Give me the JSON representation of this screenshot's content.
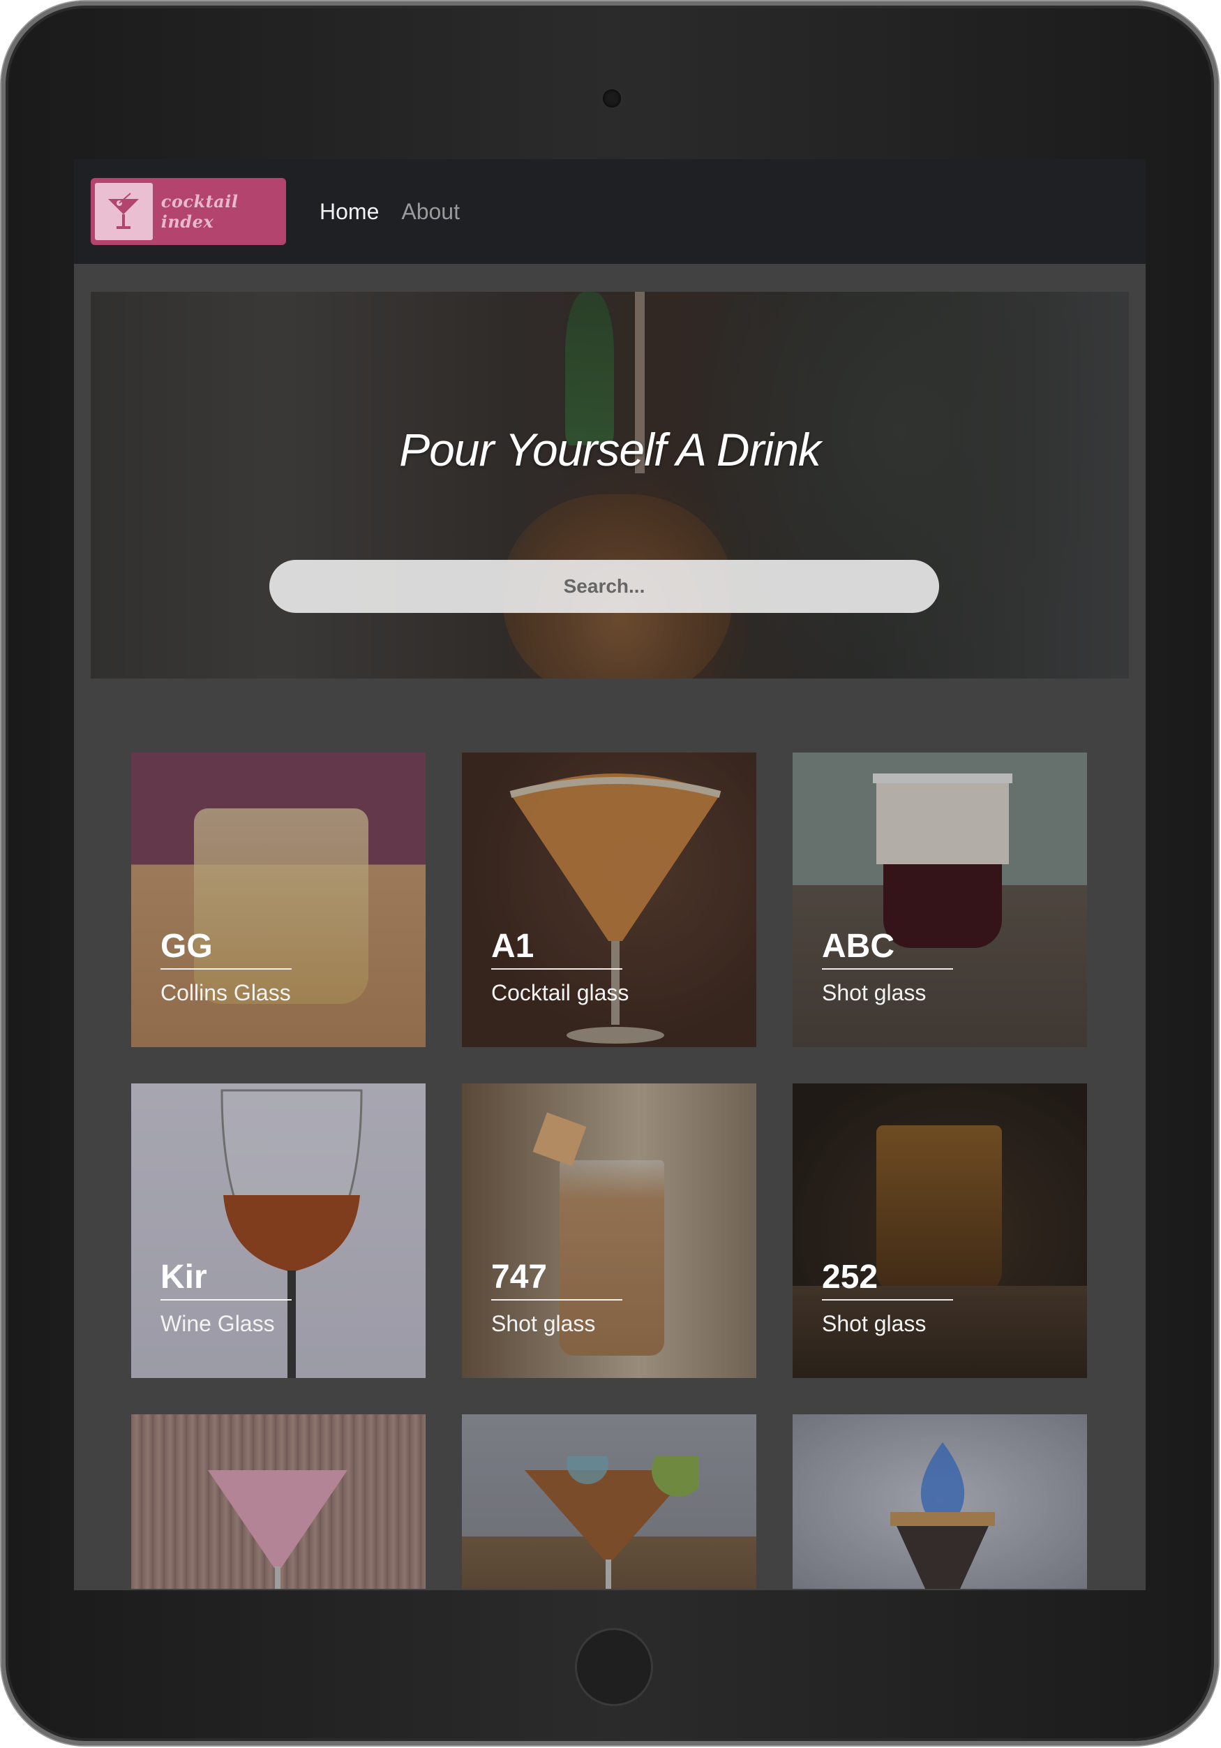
{
  "navbar": {
    "logo_text": "cocktail index",
    "links": [
      "Home",
      "About"
    ]
  },
  "hero": {
    "title": "Pour Yourself A Drink",
    "search_placeholder": "Search..."
  },
  "cards": [
    {
      "name": "GG",
      "glass": "Collins Glass"
    },
    {
      "name": "A1",
      "glass": "Cocktail glass"
    },
    {
      "name": "ABC",
      "glass": "Shot glass"
    },
    {
      "name": "Kir",
      "glass": "Wine Glass"
    },
    {
      "name": "747",
      "glass": "Shot glass"
    },
    {
      "name": "252",
      "glass": "Shot glass"
    }
  ],
  "colors": {
    "navbar_bg": "#1f2024",
    "page_bg": "#424242",
    "logo_bg": "#b3446e",
    "logo_mark": "#e9bfd1"
  }
}
